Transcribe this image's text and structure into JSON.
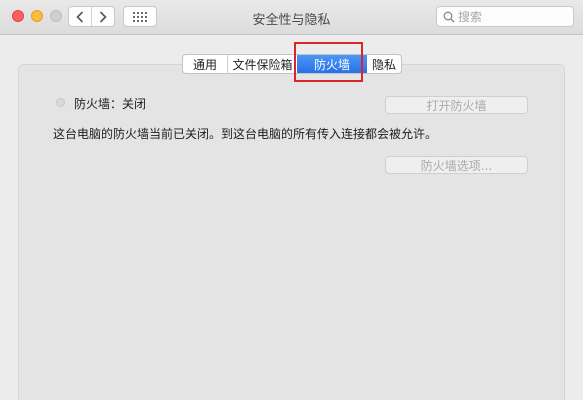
{
  "window": {
    "title": "安全性与隐私"
  },
  "search": {
    "placeholder": "搜索",
    "value": ""
  },
  "tabs": [
    {
      "label": "通用",
      "selected": false
    },
    {
      "label": "文件保险箱",
      "selected": false
    },
    {
      "label": "防火墙",
      "selected": true
    },
    {
      "label": "隐私",
      "selected": false
    }
  ],
  "firewall": {
    "status": "防火墙：关闭",
    "description": "这台电脑的防火墙当前已关闭。到这台电脑的所有传入连接都会被允许。",
    "turn_on_label": "打开防火墙",
    "options_label": "防火墙选项..."
  },
  "colors": {
    "accent": "#2f7ff0",
    "highlight_box": "#d8262c",
    "close": "#fc605c",
    "minimize": "#fdbc40"
  },
  "icons": {
    "back": "chevron-left-icon",
    "forward": "chevron-right-icon",
    "show_all": "grid-icon",
    "search": "search-icon"
  }
}
